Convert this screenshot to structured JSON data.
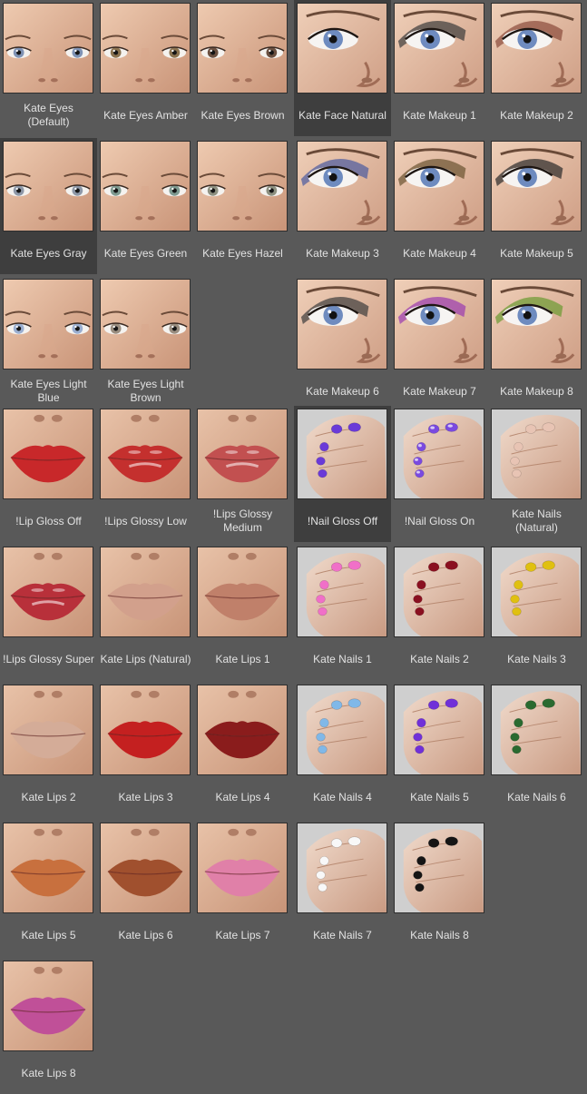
{
  "rows": [
    [
      {
        "label": "Kate Eyes\n(Default)",
        "kind": "face",
        "iris": "#7f93b5"
      },
      {
        "label": "Kate Eyes Amber",
        "kind": "face",
        "iris": "#8b7350"
      },
      {
        "label": "Kate Eyes Brown",
        "kind": "face",
        "iris": "#6b5040"
      },
      {
        "label": "Kate Face Natural",
        "kind": "eye",
        "iris": "#6e8bbf",
        "shadow": "",
        "selected": true
      },
      {
        "label": "Kate Makeup 1",
        "kind": "eye",
        "iris": "#6e8bbf",
        "shadow": "#3a3a3a"
      },
      {
        "label": "Kate Makeup 2",
        "kind": "eye",
        "iris": "#6e8bbf",
        "shadow": "#8a4a3a"
      }
    ],
    [
      {
        "label": "Kate Eyes Gray",
        "kind": "face",
        "iris": "#8e98a8",
        "selected": true
      },
      {
        "label": "Kate Eyes Green",
        "kind": "face",
        "iris": "#7e9a90"
      },
      {
        "label": "Kate Eyes Hazel",
        "kind": "face",
        "iris": "#8d9080"
      },
      {
        "label": "Kate Makeup 3",
        "kind": "eye",
        "iris": "#6e8bbf",
        "shadow": "#4a5aa0"
      },
      {
        "label": "Kate Makeup 4",
        "kind": "eye",
        "iris": "#6e8bbf",
        "shadow": "#6a5230"
      },
      {
        "label": "Kate Makeup 5",
        "kind": "eye",
        "iris": "#6e8bbf",
        "shadow": "#2a2a2a"
      }
    ],
    [
      {
        "label": "Kate Eyes Light\nBlue",
        "kind": "face",
        "iris": "#9aaed0"
      },
      {
        "label": "Kate Eyes Light\nBrown",
        "kind": "face",
        "iris": "#9a8e80"
      },
      null,
      {
        "label": "Kate Makeup 6",
        "kind": "eye",
        "iris": "#6e8bbf",
        "shadow": "#3c3c3c"
      },
      {
        "label": "Kate Makeup 7",
        "kind": "eye",
        "iris": "#6e8bbf",
        "shadow": "#9a3ab0"
      },
      {
        "label": "Kate Makeup 8",
        "kind": "eye",
        "iris": "#6e8bbf",
        "shadow": "#6a9a30"
      }
    ],
    [
      {
        "label": "!Lip Gloss Off",
        "kind": "lips",
        "lip": "#c8282a"
      },
      {
        "label": "!Lips Glossy Low",
        "kind": "lips",
        "lip": "#c4302e",
        "gloss": true
      },
      {
        "label": "!Lips Glossy\nMedium",
        "kind": "lips",
        "lip": "#c25050",
        "gloss": true
      },
      {
        "label": "!Nail Gloss Off",
        "kind": "nails",
        "nail": "#6a3ad8",
        "selected": true
      },
      {
        "label": "!Nail Gloss On",
        "kind": "nails",
        "nail": "#7a4ae0",
        "gloss": true
      },
      {
        "label": "Kate Nails\n(Natural)",
        "kind": "nails",
        "nail": "#e8c4b4"
      }
    ],
    [
      {
        "label": "!Lips Glossy Super",
        "kind": "lips",
        "lip": "#b8303a",
        "gloss": true
      },
      {
        "label": "Kate Lips (Natural)",
        "kind": "lips",
        "lip": "#d2a08c"
      },
      {
        "label": "Kate Lips 1",
        "kind": "lips",
        "lip": "#c0806a"
      },
      {
        "label": "Kate Nails 1",
        "kind": "nails",
        "nail": "#f070c8"
      },
      {
        "label": "Kate Nails 2",
        "kind": "nails",
        "nail": "#8a1020"
      },
      {
        "label": "Kate Nails 3",
        "kind": "nails",
        "nail": "#e0c010"
      }
    ],
    [
      {
        "label": "Kate Lips 2",
        "kind": "lips",
        "lip": "#d4ac98"
      },
      {
        "label": "Kate Lips 3",
        "kind": "lips",
        "lip": "#c42020"
      },
      {
        "label": "Kate Lips 4",
        "kind": "lips",
        "lip": "#8a1c1c"
      },
      {
        "label": "Kate Nails 4",
        "kind": "nails",
        "nail": "#80b8e8"
      },
      {
        "label": "Kate Nails 5",
        "kind": "nails",
        "nail": "#7030d8"
      },
      {
        "label": "Kate Nails 6",
        "kind": "nails",
        "nail": "#2a6a30"
      }
    ],
    [
      {
        "label": "Kate Lips 5",
        "kind": "lips",
        "lip": "#c8703e"
      },
      {
        "label": "Kate Lips 6",
        "kind": "lips",
        "lip": "#a0502e"
      },
      {
        "label": "Kate Lips 7",
        "kind": "lips",
        "lip": "#e080a8"
      },
      {
        "label": "Kate Nails 7",
        "kind": "nails",
        "nail": "#f8f8f8"
      },
      {
        "label": "Kate Nails 8",
        "kind": "nails",
        "nail": "#151515"
      },
      null
    ],
    [
      {
        "label": "Kate Lips 8",
        "kind": "lips",
        "lip": "#c05098"
      },
      null,
      null,
      null,
      null,
      null
    ]
  ]
}
